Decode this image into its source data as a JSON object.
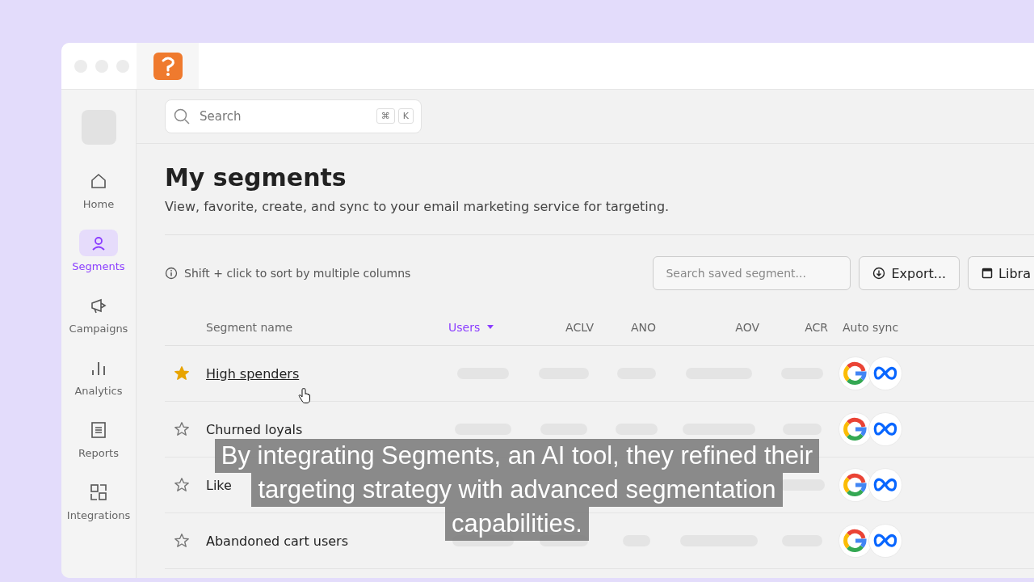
{
  "search": {
    "placeholder": "Search",
    "shortcut_keys": [
      "⌘",
      "K"
    ]
  },
  "sidebar": {
    "items": [
      {
        "label": "Home",
        "selected": false
      },
      {
        "label": "Segments",
        "selected": true
      },
      {
        "label": "Campaigns",
        "selected": false
      },
      {
        "label": "Analytics",
        "selected": false
      },
      {
        "label": "Reports",
        "selected": false
      },
      {
        "label": "Integrations",
        "selected": false
      }
    ]
  },
  "page": {
    "title": "My segments",
    "subtitle": "View, favorite, create, and sync to your email marketing service for targeting."
  },
  "toolbar": {
    "hint": "Shift + click to sort by multiple columns",
    "search_placeholder": "Search saved segment...",
    "buttons": [
      {
        "label": "Export...",
        "kind": "export"
      },
      {
        "label": "Libra",
        "kind": "library"
      }
    ]
  },
  "table": {
    "columns": [
      {
        "label": "Segment name",
        "sorted": false
      },
      {
        "label": "Users",
        "sorted": true
      },
      {
        "label": "ACLV",
        "sorted": false
      },
      {
        "label": "ANO",
        "sorted": false
      },
      {
        "label": "AOV",
        "sorted": false
      },
      {
        "label": "ACR",
        "sorted": false
      },
      {
        "label": "Auto sync",
        "sorted": false
      }
    ],
    "rows": [
      {
        "name": "High spenders",
        "starred": true,
        "hovered": true
      },
      {
        "name": "Churned loyals",
        "starred": false,
        "hovered": false
      },
      {
        "name": "Like",
        "starred": false,
        "hovered": false
      },
      {
        "name": "Abandoned cart users",
        "starred": false,
        "hovered": false
      }
    ]
  },
  "captions": [
    "By integrating Segments, an AI tool, they refined their",
    "targeting strategy with advanced segmentation",
    "capabilities."
  ]
}
